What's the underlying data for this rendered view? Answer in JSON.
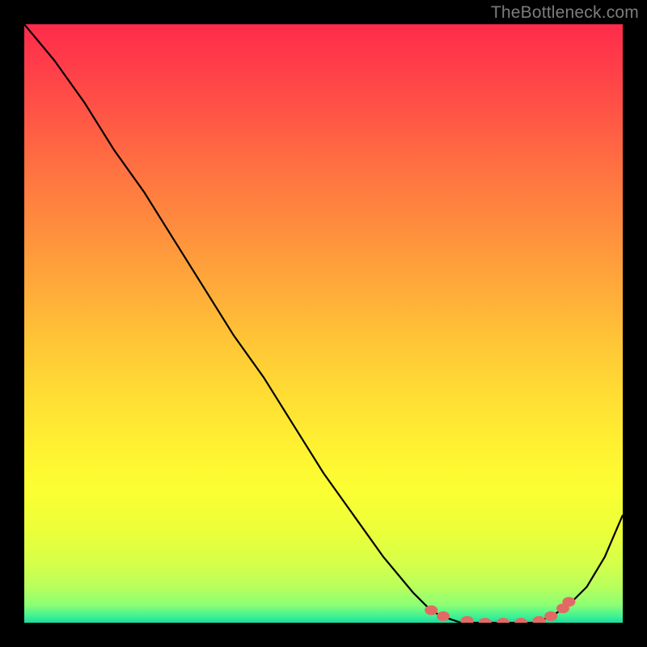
{
  "watermark": "TheBottleneck.com",
  "chart_data": {
    "type": "line",
    "title": "",
    "xlabel": "",
    "ylabel": "",
    "xlim": [
      0,
      1
    ],
    "ylim": [
      0,
      1
    ],
    "series": [
      {
        "name": "bottleneck-curve",
        "x": [
          0.0,
          0.05,
          0.1,
          0.15,
          0.2,
          0.25,
          0.3,
          0.35,
          0.4,
          0.45,
          0.5,
          0.55,
          0.6,
          0.65,
          0.68,
          0.7,
          0.73,
          0.77,
          0.81,
          0.85,
          0.88,
          0.91,
          0.94,
          0.97,
          1.0
        ],
        "y": [
          1.0,
          0.94,
          0.87,
          0.79,
          0.72,
          0.64,
          0.56,
          0.48,
          0.41,
          0.33,
          0.25,
          0.18,
          0.11,
          0.05,
          0.02,
          0.01,
          0.0,
          0.0,
          0.0,
          0.0,
          0.01,
          0.03,
          0.06,
          0.11,
          0.18
        ]
      },
      {
        "name": "highlight-dots",
        "x": [
          0.68,
          0.7,
          0.74,
          0.77,
          0.8,
          0.83,
          0.86,
          0.88,
          0.9,
          0.91
        ],
        "y": [
          0.021,
          0.011,
          0.003,
          0.0,
          0.0,
          0.0,
          0.003,
          0.011,
          0.024,
          0.035
        ]
      }
    ],
    "colors": {
      "curve": "#000000",
      "dots": "#e36a64",
      "gradient_top": "#ff2b4a",
      "gradient_mid": "#ffe433",
      "gradient_bottom": "#1fd9a0"
    }
  }
}
